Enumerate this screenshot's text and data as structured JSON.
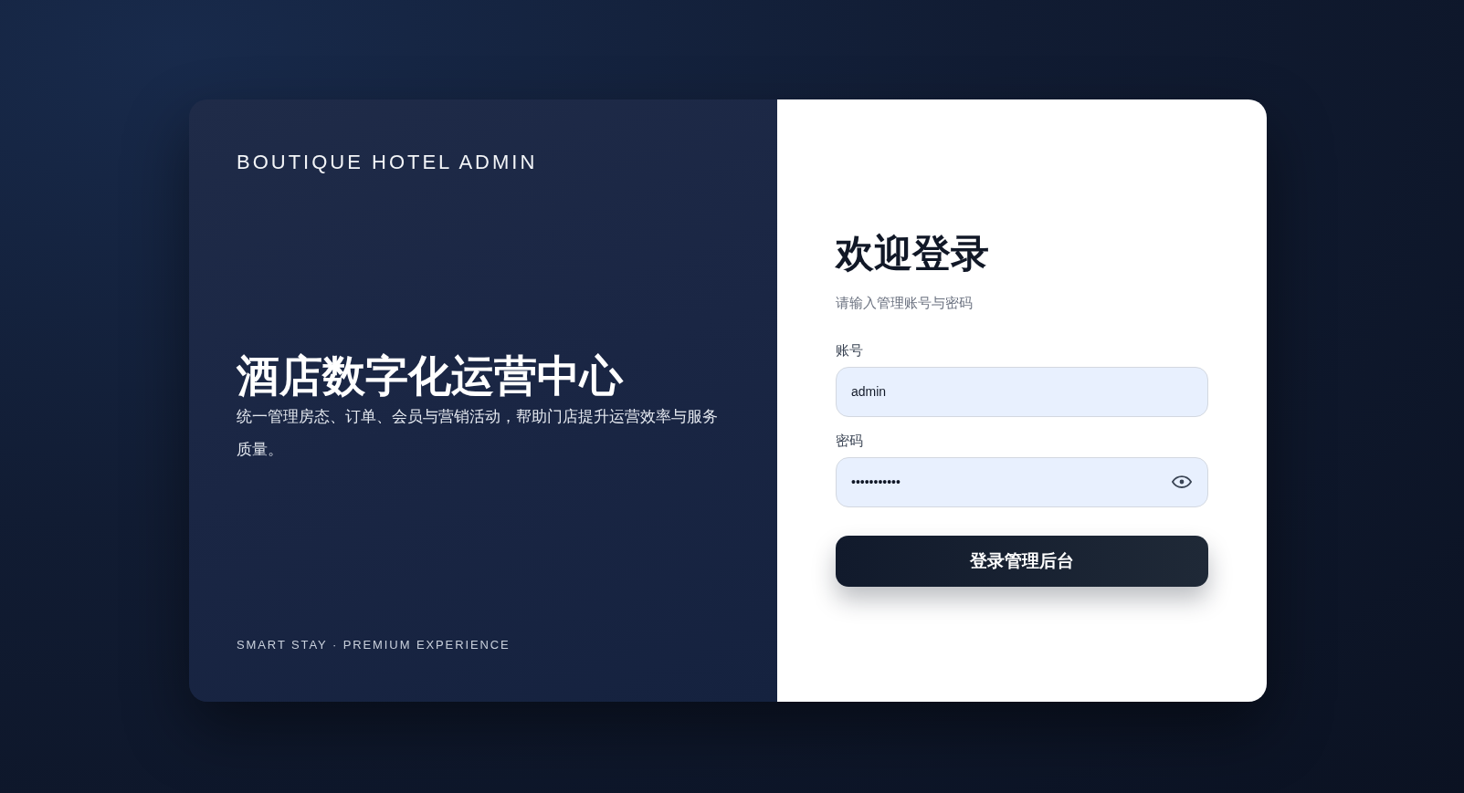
{
  "brand": {
    "title": "BOUTIQUE HOTEL ADMIN"
  },
  "hero": {
    "heading": "酒店数字化运营中心",
    "description": "统一管理房态、订单、会员与营销活动，帮助门店提升运营效率与服务质量。"
  },
  "tagline": "SMART STAY · PREMIUM EXPERIENCE",
  "login": {
    "title": "欢迎登录",
    "subtitle": "请输入管理账号与密码",
    "fields": [
      {
        "kind": "text",
        "label": "账号",
        "value": "admin"
      },
      {
        "kind": "password",
        "label": "密码",
        "value": "•••••••••••"
      }
    ],
    "submit": "登录管理后台"
  }
}
